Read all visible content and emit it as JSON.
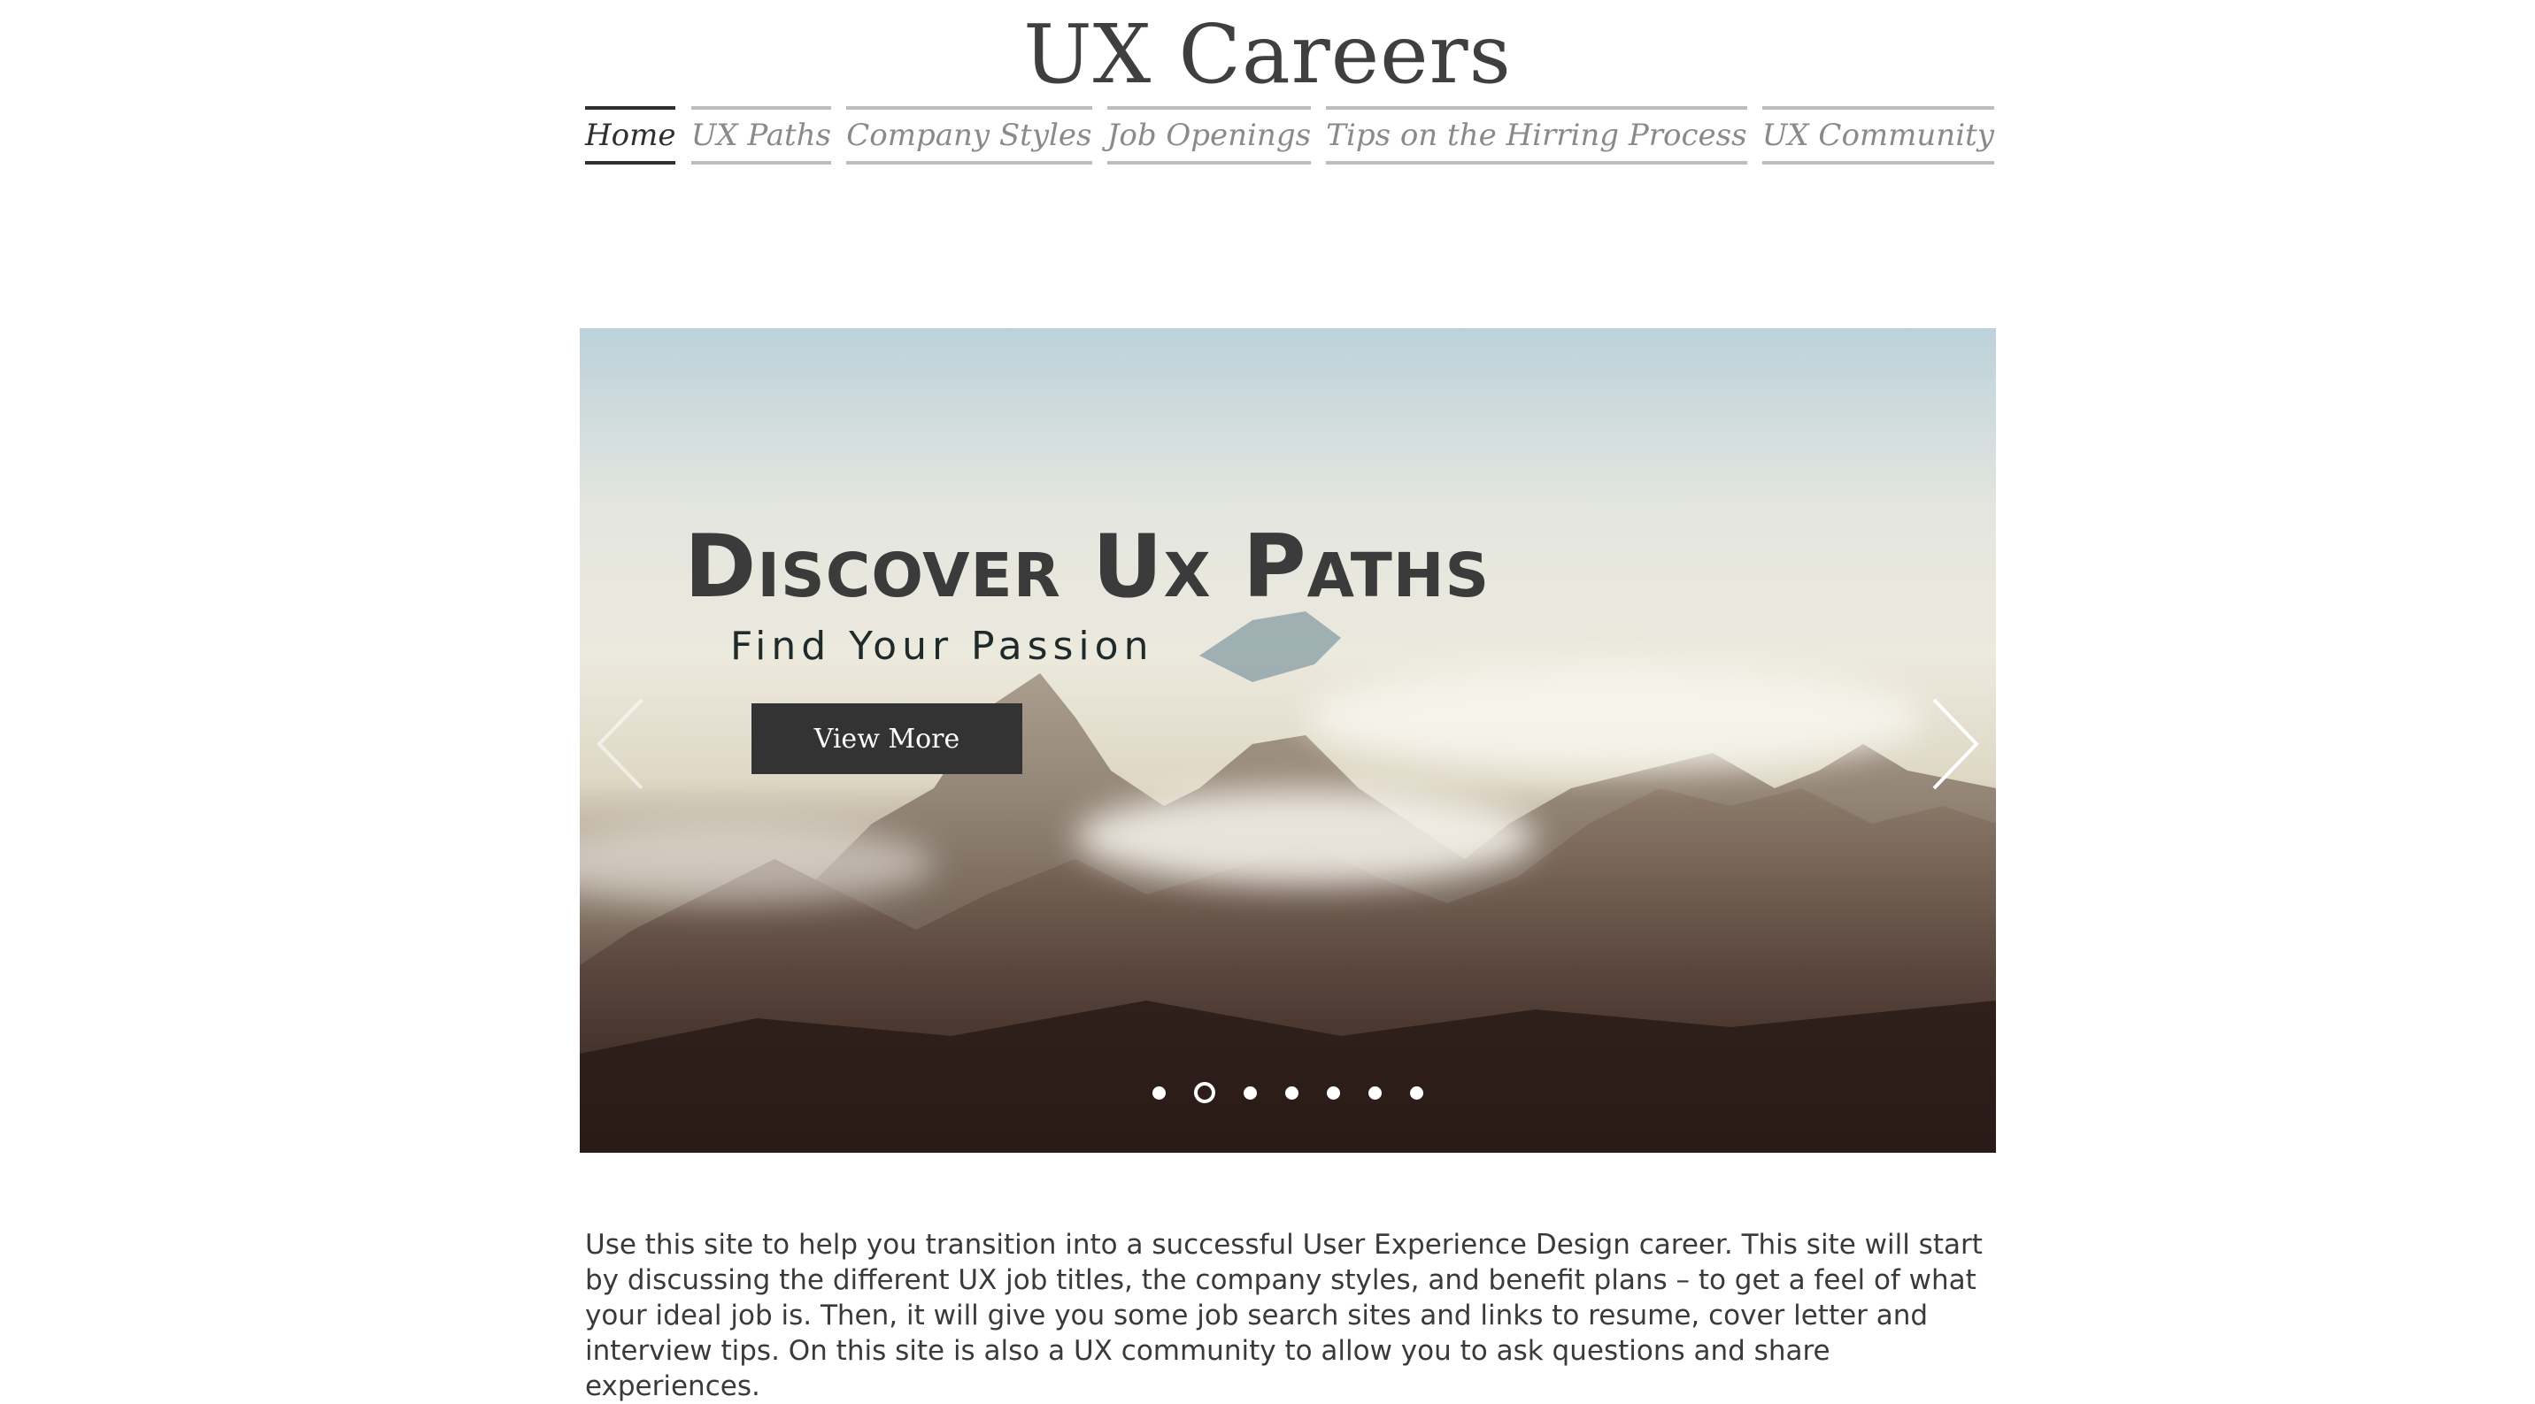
{
  "header": {
    "site_title": "UX Careers"
  },
  "nav": {
    "items": [
      {
        "label": "Home",
        "active": true
      },
      {
        "label": "UX Paths"
      },
      {
        "label": "Company Styles"
      },
      {
        "label": "Job Openings"
      },
      {
        "label": "Tips on the Hirring Process"
      },
      {
        "label": "UX Community"
      }
    ]
  },
  "hero": {
    "title": "Discover Ux Paths",
    "subtitle": "Find Your Passion",
    "button_label": "View More",
    "slide_count": 7,
    "active_slide": 2,
    "prev_icon": "chevron-left-icon",
    "next_icon": "chevron-right-icon"
  },
  "intro": {
    "text": "Use this site to help you transition into a successful User Experience Design career. This site will start by discussing the different UX job titles, the company styles, and benefit plans – to get a feel of what your ideal job is. Then, it will give you some job search sites and links to resume, cover letter and interview tips. On this site is also a UX community to allow you to ask questions and share experiences."
  },
  "colors": {
    "text_dark": "#3c3c3c",
    "nav_inactive": "#8a8a8a",
    "button_bg": "#333333"
  }
}
